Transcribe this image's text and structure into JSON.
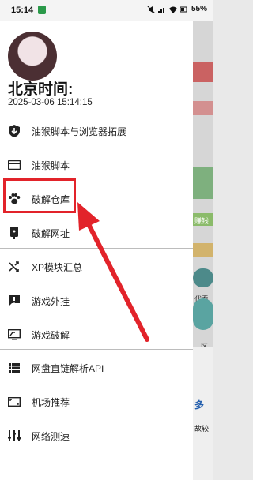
{
  "status_bar": {
    "time": "15:14",
    "battery": "55%"
  },
  "drawer": {
    "title": "北京时间:",
    "datetime": "2025-03-06 15:14:15",
    "items": [
      {
        "label": "油猴脚本与浏览器拓展",
        "icon": "shield-download-icon"
      },
      {
        "label": "油猴脚本",
        "icon": "credit-card-icon"
      },
      {
        "label": "破解仓库",
        "icon": "paw-icon"
      },
      {
        "label": "破解网址",
        "icon": "phone-sensor-icon"
      },
      {
        "label": "XP模块汇总",
        "icon": "shuffle-icon"
      },
      {
        "label": "游戏外挂",
        "icon": "alert-message-icon"
      },
      {
        "label": "游戏破解",
        "icon": "screen-share-icon"
      },
      {
        "label": "网盘直链解析API",
        "icon": "list-icon"
      },
      {
        "label": "机场推荐",
        "icon": "aspect-ratio-icon"
      },
      {
        "label": "网络测速",
        "icon": "equalizer-icon"
      }
    ]
  },
  "background_app": {
    "labels": [
      "赚钱",
      "代看区",
      "区",
      "多",
      "故较"
    ]
  },
  "colors": {
    "highlight": "#e2232a",
    "arrow": "#e2232a"
  }
}
